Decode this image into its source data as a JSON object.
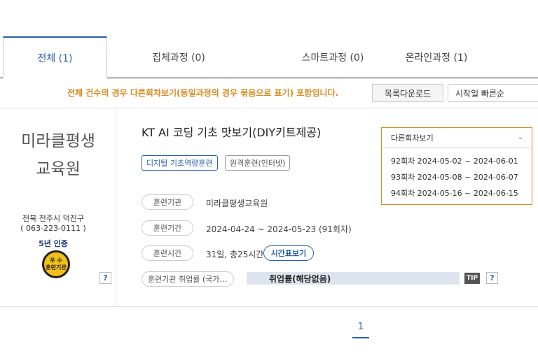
{
  "tabs": [
    {
      "label": "전체 (1)",
      "active": true
    },
    {
      "label": "집체과정 (0)",
      "active": false
    },
    {
      "label": "스마트과정 (0)",
      "active": false
    },
    {
      "label": "온라인과정 (1)",
      "active": false
    }
  ],
  "notice": "전체 건수의 경우 다른회차보기(동일과정의 경우 묶음으로 표기) 포함입니다.",
  "toolbar": {
    "download_label": "목록다운로드",
    "sort_selected": "시작일 빠른순"
  },
  "org": {
    "name": "미라클평생\n교육원",
    "address": "전북 전주시 덕진구",
    "phone": "( 063-223-0111 )",
    "cert": "5년 인증",
    "badge_line1": "우 수",
    "badge_line2": "훈련기관",
    "help": "?"
  },
  "course": {
    "title": "KT AI 코딩 기초 맛보기(DIY키트제공)",
    "tags": [
      "디지털 기초역량훈련",
      "원격훈련(인터넷)"
    ],
    "info": [
      {
        "label": "훈련기관",
        "value": "미라클평생교육원"
      },
      {
        "label": "훈련기간",
        "value": "2024-04-24 ~ 2024-05-23 (91회차)"
      },
      {
        "label": "훈련시간",
        "value": "31일, 총25시간"
      }
    ],
    "schedule_button": "시간표보기",
    "employment_label": "훈련기관 취업률 (국가…",
    "employment_value": "취업률(해당없음)",
    "tip": "TIP",
    "help": "?"
  },
  "sessions": {
    "header": "다른회차보기",
    "items": [
      "92회차 2024-05-02 ~ 2024-06-01",
      "93회차 2024-05-08 ~ 2024-06-07",
      "94회차 2024-05-16 ~ 2024-06-15"
    ]
  },
  "pagination": {
    "current": "1"
  },
  "colors": {
    "accent": "#2a5fb0",
    "notice": "#d98a1c",
    "badge": "#f2c01a"
  }
}
